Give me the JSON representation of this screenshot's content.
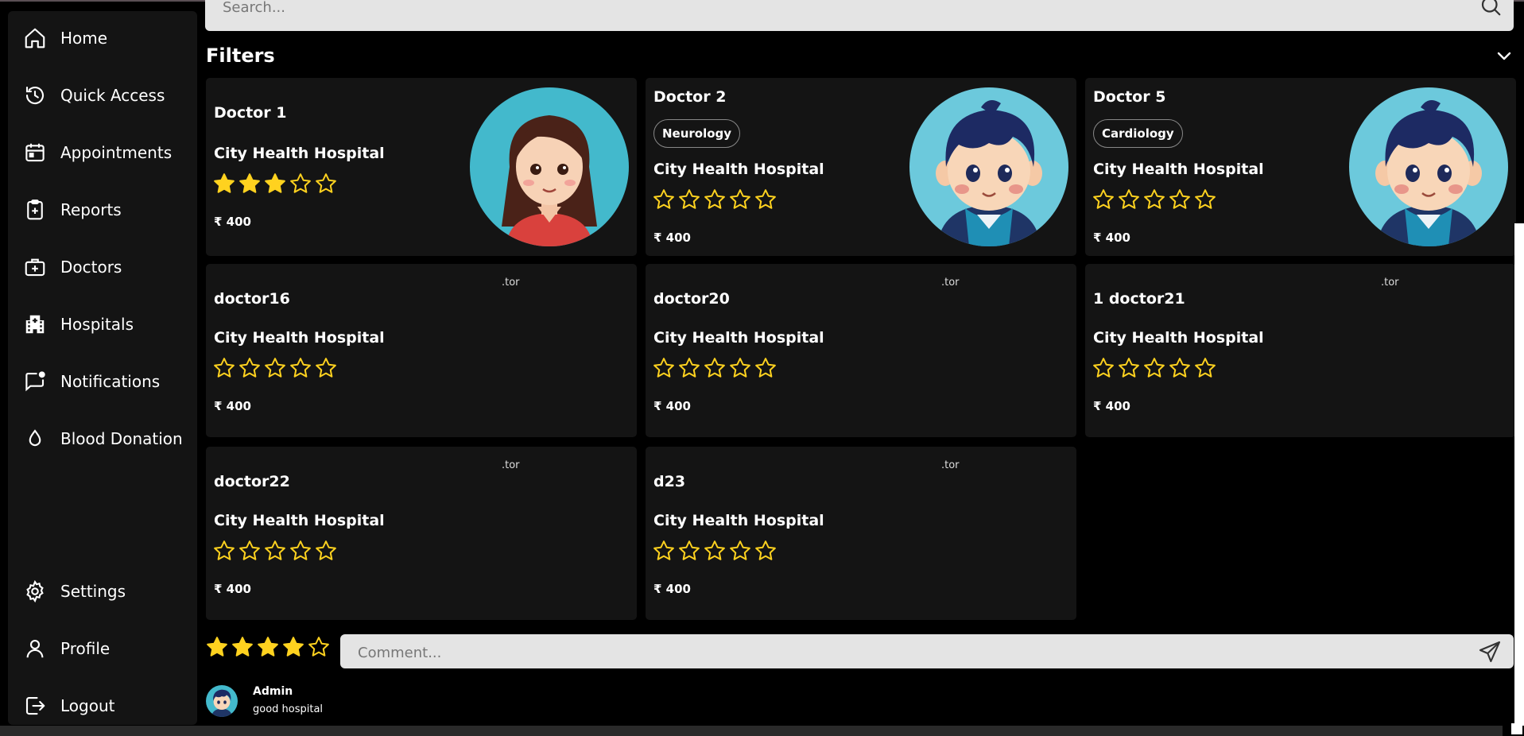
{
  "sidebar": {
    "items": [
      {
        "label": "Home",
        "icon": "home-icon"
      },
      {
        "label": "Quick Access",
        "icon": "history-icon"
      },
      {
        "label": "Appointments",
        "icon": "calendar-icon"
      },
      {
        "label": "Reports",
        "icon": "clipboard-plus-icon"
      },
      {
        "label": "Doctors",
        "icon": "medical-bag-icon"
      },
      {
        "label": "Hospitals",
        "icon": "hospital-building-icon"
      },
      {
        "label": "Notifications",
        "icon": "message-dot-icon"
      },
      {
        "label": "Blood Donation",
        "icon": "droplet-icon"
      }
    ],
    "bottom_items": [
      {
        "label": "Settings",
        "icon": "gear-icon"
      },
      {
        "label": "Profile",
        "icon": "user-icon"
      },
      {
        "label": "Logout",
        "icon": "logout-icon"
      }
    ]
  },
  "search": {
    "placeholder": "Search..."
  },
  "filters": {
    "title": "Filters"
  },
  "doctors": [
    {
      "name": "Doctor 1",
      "specialty": "",
      "hospital": "City Health Hospital",
      "rating": 3,
      "fee": "₹ 400",
      "avatar": "female"
    },
    {
      "name": "Doctor 2",
      "specialty": "Neurology",
      "hospital": "City Health Hospital",
      "rating": 0,
      "fee": "₹ 400",
      "avatar": "male"
    },
    {
      "name": "Doctor 5",
      "specialty": "Cardiology",
      "hospital": "City Health Hospital",
      "rating": 0,
      "fee": "₹ 400",
      "avatar": "male"
    },
    {
      "name": "doctor16",
      "specialty": "",
      "hospital": "City Health Hospital",
      "rating": 0,
      "fee": "₹ 400",
      "avatar": "broken",
      "broken_text": ".tor"
    },
    {
      "name": "doctor20",
      "specialty": "",
      "hospital": "City Health Hospital",
      "rating": 0,
      "fee": "₹ 400",
      "avatar": "broken",
      "broken_text": ".tor"
    },
    {
      "name": "1 doctor21",
      "specialty": "",
      "hospital": "City Health Hospital",
      "rating": 0,
      "fee": "₹ 400",
      "avatar": "broken",
      "broken_text": ".tor"
    },
    {
      "name": "doctor22",
      "specialty": "",
      "hospital": "City Health Hospital",
      "rating": 0,
      "fee": "₹ 400",
      "avatar": "broken",
      "broken_text": ".tor"
    },
    {
      "name": "d23",
      "specialty": "",
      "hospital": "City Health Hospital",
      "rating": 0,
      "fee": "₹ 400",
      "avatar": "broken",
      "broken_text": ".tor"
    }
  ],
  "review_form": {
    "rating": 4,
    "comment_placeholder": "Comment..."
  },
  "reviews": [
    {
      "author": "Admin",
      "text": "good hospital"
    }
  ],
  "colors": {
    "star": "#ffd21f",
    "card_bg": "#141414",
    "avatar_bg": "#43b9cc"
  }
}
